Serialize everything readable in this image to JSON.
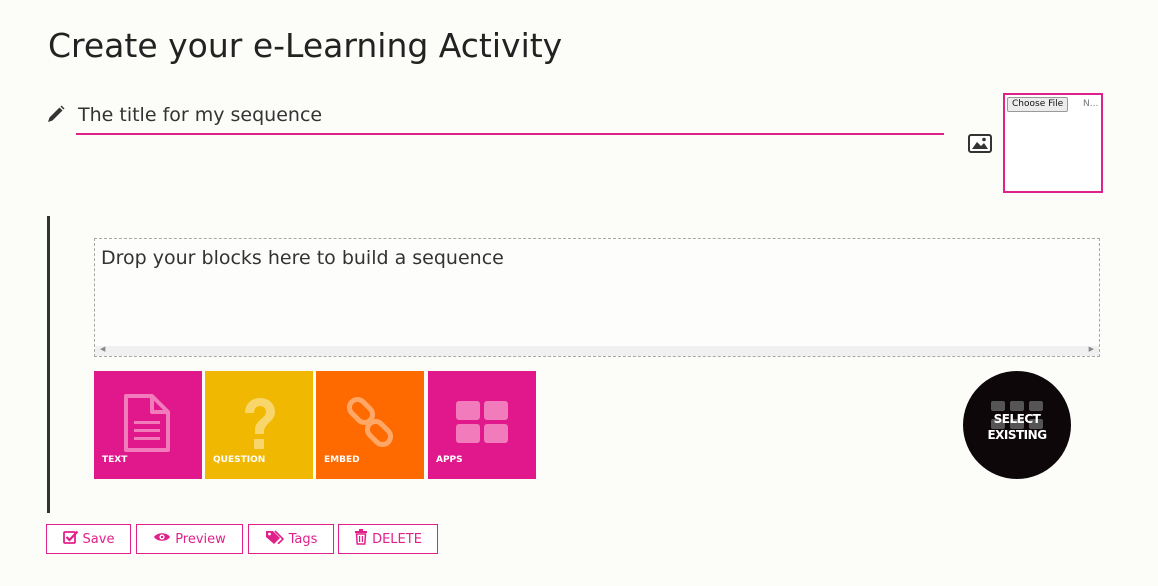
{
  "page": {
    "title": "Create your e-Learning Activity"
  },
  "sequence": {
    "title_value": "The title for my sequence",
    "choose_file_label": "Choose File",
    "no_file_label": "N..."
  },
  "dropzone": {
    "text": "Drop your blocks here to build a sequence"
  },
  "blocks": {
    "text": {
      "label": "TEXT",
      "color": "#e0188c"
    },
    "question": {
      "label": "QUESTION",
      "color": "#f0b800"
    },
    "embed": {
      "label": "EMBED",
      "color": "#ff6a00"
    },
    "apps": {
      "label": "APPS",
      "color": "#e0188c"
    }
  },
  "select_existing": {
    "line1": "SELECT",
    "line2": "EXISTING"
  },
  "actions": {
    "save": "Save",
    "preview": "Preview",
    "tags": "Tags",
    "delete": "DELETE"
  },
  "colors": {
    "accent": "#e0218a",
    "background": "#fcfcf9"
  },
  "icons": {
    "title": "pencil-icon",
    "image": "image-icon",
    "text_block": "document-icon",
    "question_block": "question-icon",
    "embed_block": "link-icon",
    "apps_block": "grid-icon",
    "save": "checkbox-icon",
    "preview": "eye-icon",
    "tags": "tags-icon",
    "delete": "trash-icon"
  }
}
